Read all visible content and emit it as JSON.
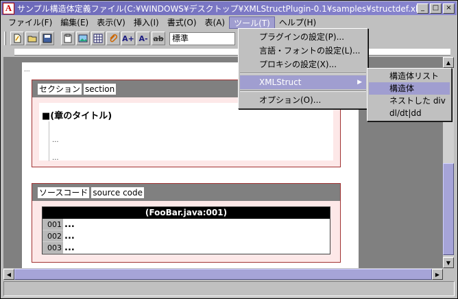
{
  "window": {
    "title": "サンプル構造体定義ファイル(C:¥WINDOWS¥デスクトップ¥XMLStructPlugin-0.1¥samples¥structdef.xhtml) - 一太郎Ark",
    "app_icon_glyph": "A",
    "minimize": "_",
    "maximize": "□",
    "close": "×"
  },
  "menubar": [
    "ファイル(F)",
    "編集(E)",
    "表示(V)",
    "挿入(I)",
    "書式(O)",
    "表(A)",
    "ツール(T)",
    "ヘルプ(H)"
  ],
  "toolbar": {
    "style_value": "標準",
    "buttons": [
      "new-doc-icon",
      "open-icon",
      "save-icon",
      "paste-icon",
      "image-icon",
      "table-icon",
      "attach-icon",
      "font-grow-icon",
      "font-shrink-icon",
      "strike-icon"
    ],
    "font_grow": "A+",
    "font_shrink": "A-",
    "strike": "ab",
    "dropdown_arrow": "▼"
  },
  "tools_menu": {
    "items": [
      {
        "label": "プラグインの設定(P)..."
      },
      {
        "label": "言語・フォントの設定(L)..."
      },
      {
        "label": "プロキシの設定(X)..."
      },
      {
        "label": "XMLStruct",
        "submenu": true
      },
      {
        "label": "オプション(O)..."
      }
    ],
    "submenu_arrow": "▶"
  },
  "xmlstruct_submenu": [
    "構造体リスト",
    "構造体",
    "ネストした div",
    "dl/dt|dd"
  ],
  "document": {
    "para_mark": "...",
    "section1": {
      "tag_ja": "セクション",
      "tag_en": "section",
      "heading": "■(章のタイトル)",
      "line1": "...",
      "line2": "..."
    },
    "section2": {
      "tag_ja": "ソースコード",
      "tag_en": "source code",
      "code_title": "(FooBar.java:001)",
      "lines": [
        {
          "no": "001",
          "text": "..."
        },
        {
          "no": "002",
          "text": "..."
        },
        {
          "no": "003",
          "text": "..."
        }
      ]
    }
  },
  "scroll": {
    "up": "▲",
    "down": "▼",
    "left": "◀",
    "right": "▶"
  }
}
